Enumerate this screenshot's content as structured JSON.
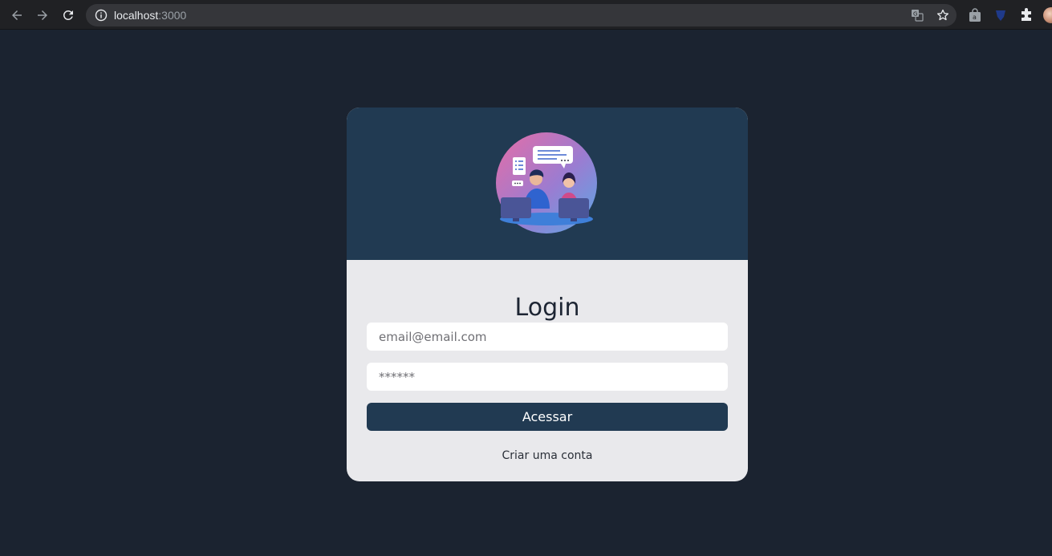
{
  "browser": {
    "url_host": "localhost",
    "url_port": ":3000",
    "icons": {
      "back": "arrow-left-icon",
      "forward": "arrow-right-icon",
      "reload": "reload-icon",
      "site_info": "info-icon",
      "translate": "translate-icon",
      "bookmark": "star-icon",
      "extension_1": "shopping-bag-icon",
      "extension_2": "shield-icon",
      "extensions_menu": "puzzle-icon",
      "profile": "avatar"
    }
  },
  "login": {
    "title": "Login",
    "email_placeholder": "email@email.com",
    "password_placeholder": "******",
    "submit_label": "Acessar",
    "create_account_label": "Criar uma conta",
    "illustration": "customer-support-illustration"
  },
  "colors": {
    "page_background": "#1b2330",
    "card_header": "#213a52",
    "card_body": "#e9e9ec",
    "button": "#213a52"
  }
}
